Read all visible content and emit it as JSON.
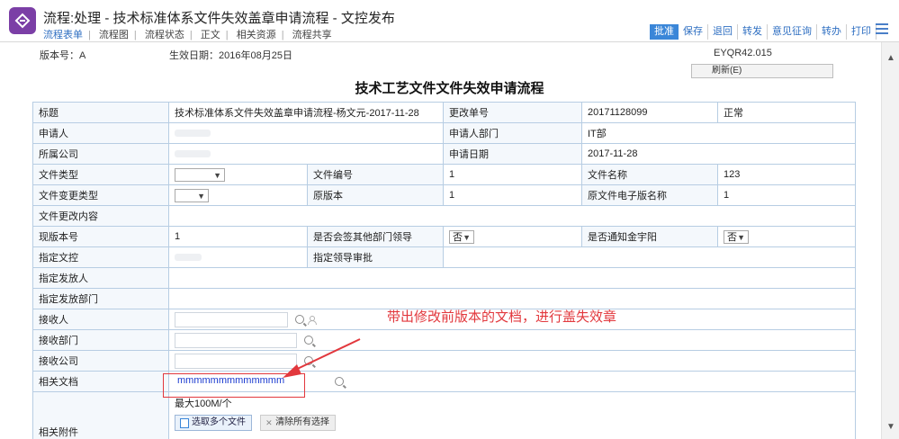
{
  "header": {
    "title": "流程:处理 - 技术标准体系文件失效盖章申请流程 - 文控发布",
    "subnav": [
      "流程表单",
      "流程图",
      "流程状态",
      "正文",
      "相关资源",
      "流程共享"
    ],
    "toolbar": [
      "批准",
      "保存",
      "退回",
      "转发",
      "意见征询",
      "转办",
      "打印"
    ]
  },
  "meta": {
    "version_label": "版本号：A",
    "effective_date": "生效日期：2016年08月25日",
    "doc_code": "EYQR42.015",
    "refresh_label": "刷新(E)"
  },
  "doc_title": "技术工艺文件文件失效申请流程",
  "form": {
    "r1": {
      "label": "标题",
      "value": "技术标准体系文件失效盖章申请流程-杨文元-2017-11-28",
      "label2": "更改单号",
      "value2": "20171128099",
      "status": "正常"
    },
    "r2": {
      "label": "申请人",
      "label2": "申请人部门",
      "value2": "IT部"
    },
    "r3": {
      "label": "所属公司",
      "label2": "申请日期",
      "value2": "2017-11-28"
    },
    "r4": {
      "label": "文件类型",
      "label2": "文件编号",
      "value2": "1",
      "label3": "文件名称",
      "value3": "123"
    },
    "r5": {
      "label": "文件变更类型",
      "label2": "原版本",
      "value2": "1",
      "label3": "原文件电子版名称",
      "value3": "1"
    },
    "r6": {
      "label": "文件更改内容"
    },
    "r7": {
      "label": "现版本号",
      "value": "1",
      "label2": "是否会签其他部门领导",
      "select2": "否",
      "label3": "是否通知金宇阳",
      "select3": "否"
    },
    "r8": {
      "label": "指定文控",
      "label2": "指定领导审批"
    },
    "r9": {
      "label": "指定发放人"
    },
    "r10": {
      "label": "指定发放部门"
    },
    "r11": {
      "label": "接收人"
    },
    "r12": {
      "label": "接收部门"
    },
    "r13": {
      "label": "接收公司"
    },
    "r14": {
      "label": "相关文档",
      "value": "mmmmmmmmmmmmm"
    },
    "r15": {
      "label": "相关附件",
      "limit": "最大100M/个",
      "upload_label": "选取多个文件",
      "clear_label": "清除所有选择"
    }
  },
  "annotation": "带出修改前版本的文档，进行盖失效章",
  "colors": {
    "accent": "#3a86d8",
    "annotation": "#e2383d",
    "app_icon": "#7b3fa6"
  }
}
